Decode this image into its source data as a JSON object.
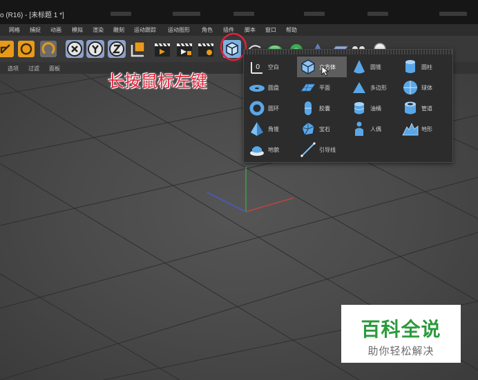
{
  "window": {
    "title": "o (R16) - [未标题 1 *]"
  },
  "menu": [
    "网格",
    "捕捉",
    "动画",
    "模拟",
    "渲染",
    "雕刻",
    "运动跟踪",
    "运动图形",
    "角色",
    "插件",
    "脚本",
    "窗口",
    "帮助"
  ],
  "viewport_menu": [
    "选项",
    "过滤",
    "面板"
  ],
  "toolbar": {
    "buttons": [
      "scale-tool",
      "rotate-tool",
      "rotate-tool-2",
      "x-axis",
      "y-axis",
      "z-axis",
      "coordinate-system",
      "render-view",
      "render-picture-viewer",
      "edit-render-settings",
      "cube-object",
      "pen-spline",
      "generator",
      "environment",
      "deformer",
      "camera",
      "light"
    ]
  },
  "instruction": "长按鼠标左键",
  "primitives": {
    "items": [
      {
        "label": "空白",
        "icon": "null-icon"
      },
      {
        "label": "立方体",
        "icon": "cube-icon"
      },
      {
        "label": "圆锥",
        "icon": "cone-icon"
      },
      {
        "label": "圆柱",
        "icon": "cylinder-icon"
      },
      {
        "label": "圆盘",
        "icon": "disc-icon"
      },
      {
        "label": "平面",
        "icon": "plane-icon"
      },
      {
        "label": "多边形",
        "icon": "polygon-icon"
      },
      {
        "label": "球体",
        "icon": "sphere-icon"
      },
      {
        "label": "圆环",
        "icon": "torus-icon"
      },
      {
        "label": "胶囊",
        "icon": "capsule-icon"
      },
      {
        "label": "油桶",
        "icon": "oil-tank-icon"
      },
      {
        "label": "管道",
        "icon": "tube-icon"
      },
      {
        "label": "角锥",
        "icon": "pyramid-icon"
      },
      {
        "label": "宝石",
        "icon": "platonic-icon"
      },
      {
        "label": "人偶",
        "icon": "figure-icon"
      },
      {
        "label": "地形",
        "icon": "landscape-icon"
      },
      {
        "label": "地貌",
        "icon": "relief-icon"
      },
      {
        "label": "引导线",
        "icon": "guide-icon"
      }
    ]
  },
  "watermark": {
    "line1": "百科全说",
    "line2": "助你轻松解决"
  },
  "colors": {
    "accent": "#e3233a",
    "highlight": "#5e5e5e",
    "watermark_green": "#2b9a3c"
  }
}
